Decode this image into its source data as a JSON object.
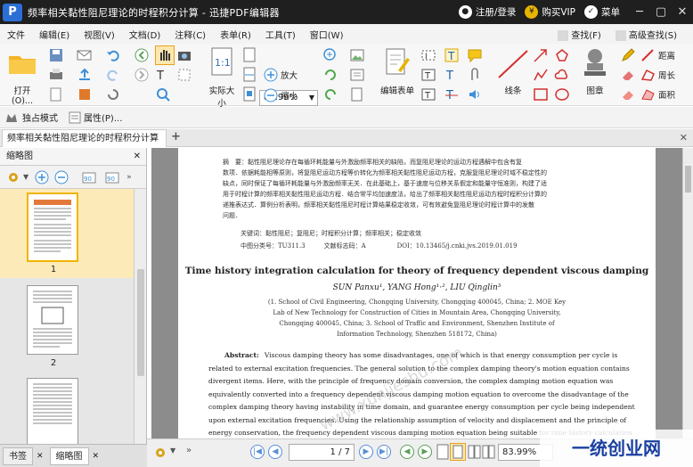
{
  "app": {
    "logo": "P",
    "title": "频率相关黏性阻尼理论的时程积分计算 - 迅捷PDF编辑器",
    "register": "注册/登录",
    "vip": "购买VIP",
    "menu": "菜单",
    "minimize": "─",
    "maximize": "▢",
    "close": "✕"
  },
  "menubar": {
    "items": [
      "文件",
      "编辑(E)",
      "视图(V)",
      "文档(D)",
      "注释(C)",
      "表单(R)",
      "工具(T)",
      "窗口(W)"
    ],
    "find": "查找(F)",
    "advfind": "高级查找(S)"
  },
  "ribbon": {
    "open": "打开(O)...",
    "zoom_value": "83.99%",
    "actual_size": "实际大小",
    "zoom_in": "放大",
    "zoom_out": "缩小",
    "edit_form": "编辑表单",
    "line": "线条",
    "stamp": "图章",
    "distance": "距离",
    "perimeter": "周长",
    "area": "面积"
  },
  "subbar": {
    "exclusive_mode": "独占模式",
    "properties": "属性(P)..."
  },
  "tabs": {
    "doc_tab": "频率相关黏性阻尼理论的时程积分计算",
    "add": "+",
    "close": "✕"
  },
  "sidebar": {
    "title": "缩略图",
    "close": "✕",
    "pages": [
      "1",
      "2"
    ],
    "tab_bookmark": "书签",
    "tab_thumbnail": "缩略图"
  },
  "document": {
    "cn_abstract": [
      "摘　要：黏性阻尼理论存在每循环耗能量与外激励频率相关的缺陷，而复阻尼理论的运动方程遇解中包含有复",
      "数项．依据耗能相等原则，将复阻尼运动方程等价转化为频率相关黏性阻尼运动方程，克服复阻尼理论时域不稳定性的",
      "缺点，同时保证了每循环耗能量与外激励频率无关．在此基础上，基于速度与位移关系假定和能量守恒准则，构建了适",
      "用于时程计算的频率相关黏性阻尼运动方程．结合常平均加速度法，给出了频率相关黏性阻尼运动方程时程积分计算的",
      "递推表达式．算例分析表明，频率相关黏性阻尼时程计算结果稳定收敛，可有效避免复阻尼理论时程计算中的发散",
      "问题．"
    ],
    "keywords": "关键词：黏性阻尼；复阻尼；时程积分计算；频率相关；稳定收敛",
    "clc": "中图分类号：TU311.3　　　文献标志码：A　　　　　DOI：10.13465/j.cnki.jvs.2019.01.019",
    "en_title": "Time history integration calculation for theory of frequency dependent viscous damping",
    "authors": "SUN Panxu¹, YANG Hong¹·², LIU Qinglin³",
    "affil": [
      "(1. School of Civil Engineering, Chongqing University, Chongqing 400045, China; 2. MOE Key",
      "Lab of New Technology for Construction of Cities in Mountain Area, Chongqing University,",
      "Chongqing 400045, China; 3. School of Traffic and Environment, Shenzhen Institute of",
      "Information Technology, Shenzhen 518172, China)"
    ],
    "abstract_label": "Abstract:",
    "abstract": [
      "Viscous damping theory has some disadvantages, one of which is that energy consumption per cycle is",
      "related to external excitation frequencies. The general solution to the complex damping theory's motion equation contains",
      "divergent items. Here, with the principle of frequency domain conversion, the complex damping motion equation was",
      "equivalently converted into a frequency dependent viscous damping motion equation to overcome the disadvantage of the",
      "complex damping theory having instability in time domain, and guarantee energy consumption per cycle being independent",
      "upon external excitation frequencies. Using the relationship assumption of velocity and displacement and the principle of",
      "energy conservation, the frequency dependent viscous damping motion equation being suitable for time history calculation"
    ],
    "watermark": "www.xunjieshu.com"
  },
  "status": {
    "page": "1 / 7",
    "zoom": "83.99%"
  },
  "corner_watermark": "一统创业网"
}
